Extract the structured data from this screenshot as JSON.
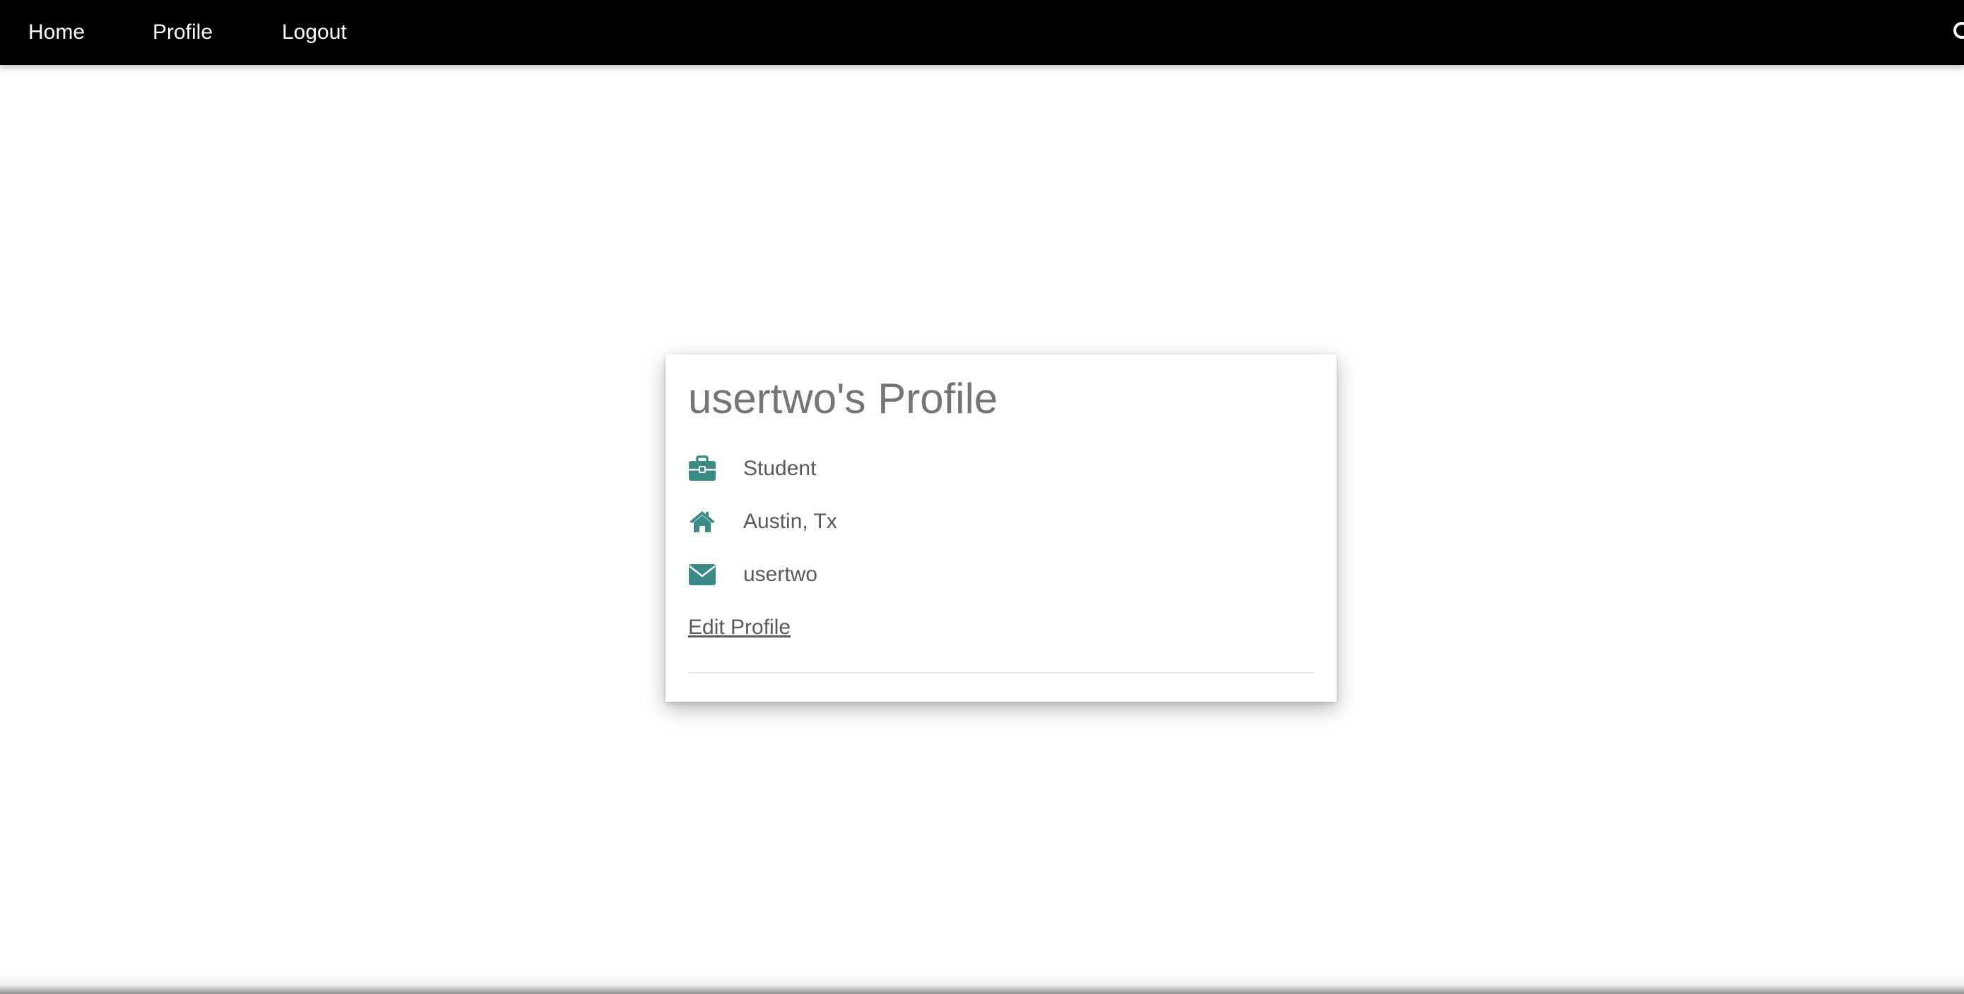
{
  "nav": {
    "home": "Home",
    "profile": "Profile",
    "logout": "Logout"
  },
  "profile": {
    "title": "usertwo's Profile",
    "occupation": "Student",
    "location": "Austin, Tx",
    "email": "usertwo",
    "edit_link": "Edit Profile"
  },
  "icons": {
    "occupation": "briefcase-icon",
    "location": "home-icon",
    "email": "envelope-icon",
    "nav_search": "search-icon"
  },
  "colors": {
    "navbar_bg": "#000000",
    "nav_text": "#ffffff",
    "icon_accent": "#3a8b85",
    "title_text": "#757575",
    "body_text": "#5a5a5a"
  }
}
